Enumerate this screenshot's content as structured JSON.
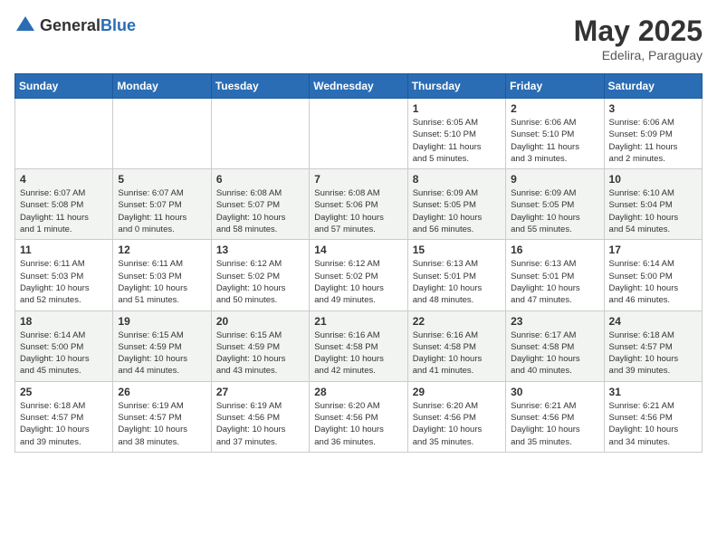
{
  "header": {
    "logo_general": "General",
    "logo_blue": "Blue",
    "title": "May 2025",
    "location": "Edelira, Paraguay"
  },
  "weekdays": [
    "Sunday",
    "Monday",
    "Tuesday",
    "Wednesday",
    "Thursday",
    "Friday",
    "Saturday"
  ],
  "weeks": [
    [
      {
        "day": "",
        "content": ""
      },
      {
        "day": "",
        "content": ""
      },
      {
        "day": "",
        "content": ""
      },
      {
        "day": "",
        "content": ""
      },
      {
        "day": "1",
        "content": "Sunrise: 6:05 AM\nSunset: 5:10 PM\nDaylight: 11 hours\nand 5 minutes."
      },
      {
        "day": "2",
        "content": "Sunrise: 6:06 AM\nSunset: 5:10 PM\nDaylight: 11 hours\nand 3 minutes."
      },
      {
        "day": "3",
        "content": "Sunrise: 6:06 AM\nSunset: 5:09 PM\nDaylight: 11 hours\nand 2 minutes."
      }
    ],
    [
      {
        "day": "4",
        "content": "Sunrise: 6:07 AM\nSunset: 5:08 PM\nDaylight: 11 hours\nand 1 minute."
      },
      {
        "day": "5",
        "content": "Sunrise: 6:07 AM\nSunset: 5:07 PM\nDaylight: 11 hours\nand 0 minutes."
      },
      {
        "day": "6",
        "content": "Sunrise: 6:08 AM\nSunset: 5:07 PM\nDaylight: 10 hours\nand 58 minutes."
      },
      {
        "day": "7",
        "content": "Sunrise: 6:08 AM\nSunset: 5:06 PM\nDaylight: 10 hours\nand 57 minutes."
      },
      {
        "day": "8",
        "content": "Sunrise: 6:09 AM\nSunset: 5:05 PM\nDaylight: 10 hours\nand 56 minutes."
      },
      {
        "day": "9",
        "content": "Sunrise: 6:09 AM\nSunset: 5:05 PM\nDaylight: 10 hours\nand 55 minutes."
      },
      {
        "day": "10",
        "content": "Sunrise: 6:10 AM\nSunset: 5:04 PM\nDaylight: 10 hours\nand 54 minutes."
      }
    ],
    [
      {
        "day": "11",
        "content": "Sunrise: 6:11 AM\nSunset: 5:03 PM\nDaylight: 10 hours\nand 52 minutes."
      },
      {
        "day": "12",
        "content": "Sunrise: 6:11 AM\nSunset: 5:03 PM\nDaylight: 10 hours\nand 51 minutes."
      },
      {
        "day": "13",
        "content": "Sunrise: 6:12 AM\nSunset: 5:02 PM\nDaylight: 10 hours\nand 50 minutes."
      },
      {
        "day": "14",
        "content": "Sunrise: 6:12 AM\nSunset: 5:02 PM\nDaylight: 10 hours\nand 49 minutes."
      },
      {
        "day": "15",
        "content": "Sunrise: 6:13 AM\nSunset: 5:01 PM\nDaylight: 10 hours\nand 48 minutes."
      },
      {
        "day": "16",
        "content": "Sunrise: 6:13 AM\nSunset: 5:01 PM\nDaylight: 10 hours\nand 47 minutes."
      },
      {
        "day": "17",
        "content": "Sunrise: 6:14 AM\nSunset: 5:00 PM\nDaylight: 10 hours\nand 46 minutes."
      }
    ],
    [
      {
        "day": "18",
        "content": "Sunrise: 6:14 AM\nSunset: 5:00 PM\nDaylight: 10 hours\nand 45 minutes."
      },
      {
        "day": "19",
        "content": "Sunrise: 6:15 AM\nSunset: 4:59 PM\nDaylight: 10 hours\nand 44 minutes."
      },
      {
        "day": "20",
        "content": "Sunrise: 6:15 AM\nSunset: 4:59 PM\nDaylight: 10 hours\nand 43 minutes."
      },
      {
        "day": "21",
        "content": "Sunrise: 6:16 AM\nSunset: 4:58 PM\nDaylight: 10 hours\nand 42 minutes."
      },
      {
        "day": "22",
        "content": "Sunrise: 6:16 AM\nSunset: 4:58 PM\nDaylight: 10 hours\nand 41 minutes."
      },
      {
        "day": "23",
        "content": "Sunrise: 6:17 AM\nSunset: 4:58 PM\nDaylight: 10 hours\nand 40 minutes."
      },
      {
        "day": "24",
        "content": "Sunrise: 6:18 AM\nSunset: 4:57 PM\nDaylight: 10 hours\nand 39 minutes."
      }
    ],
    [
      {
        "day": "25",
        "content": "Sunrise: 6:18 AM\nSunset: 4:57 PM\nDaylight: 10 hours\nand 39 minutes."
      },
      {
        "day": "26",
        "content": "Sunrise: 6:19 AM\nSunset: 4:57 PM\nDaylight: 10 hours\nand 38 minutes."
      },
      {
        "day": "27",
        "content": "Sunrise: 6:19 AM\nSunset: 4:56 PM\nDaylight: 10 hours\nand 37 minutes."
      },
      {
        "day": "28",
        "content": "Sunrise: 6:20 AM\nSunset: 4:56 PM\nDaylight: 10 hours\nand 36 minutes."
      },
      {
        "day": "29",
        "content": "Sunrise: 6:20 AM\nSunset: 4:56 PM\nDaylight: 10 hours\nand 35 minutes."
      },
      {
        "day": "30",
        "content": "Sunrise: 6:21 AM\nSunset: 4:56 PM\nDaylight: 10 hours\nand 35 minutes."
      },
      {
        "day": "31",
        "content": "Sunrise: 6:21 AM\nSunset: 4:56 PM\nDaylight: 10 hours\nand 34 minutes."
      }
    ]
  ]
}
